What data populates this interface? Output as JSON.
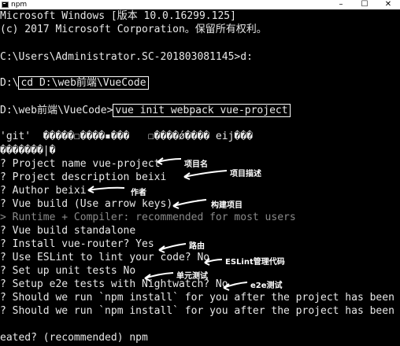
{
  "window": {
    "title": "npm",
    "minimize": "–",
    "maximize": "☐",
    "close": "✕"
  },
  "console": {
    "lines": [
      "Microsoft Windows [版本 10.0.16299.125]",
      "(c) 2017 Microsoft Corporation。保留所有权利。",
      "",
      "C:\\Users\\Administrator.SC-201803081145>d:",
      "",
      "D:\\",
      "cd D:\\web前端\\VueCode",
      "D:\\web前端\\VueCode>",
      "vue init webpack vue-project",
      "'git'  �����☐����▪���   ☐����ǿ���� eij���",
      "�������|�",
      "? Project name vue-project",
      "? Project description beixi",
      "? Author beixi",
      "? Vue build (Use arrow keys)",
      "> Runtime + Compiler: recommended for most users",
      "? Vue build standalone",
      "? Install vue-router? Yes",
      "? Use ESLint to lint your code? No",
      "? Set up unit tests No",
      "? Setup e2e tests with Nightwatch? No",
      "? Should we run `npm install` for you after the project has been cr",
      "? Should we run `npm install` for you after the project has been cr",
      "",
      "eated? (recommended) npm"
    ]
  },
  "annotations": {
    "project_name": "项目名",
    "project_description": "项目描述",
    "author": "作者",
    "vue_build": "构建项目",
    "router": "路由",
    "eslint": "ESLint管理代码",
    "unit_tests": "单元测试",
    "e2e": "e2e测试"
  }
}
